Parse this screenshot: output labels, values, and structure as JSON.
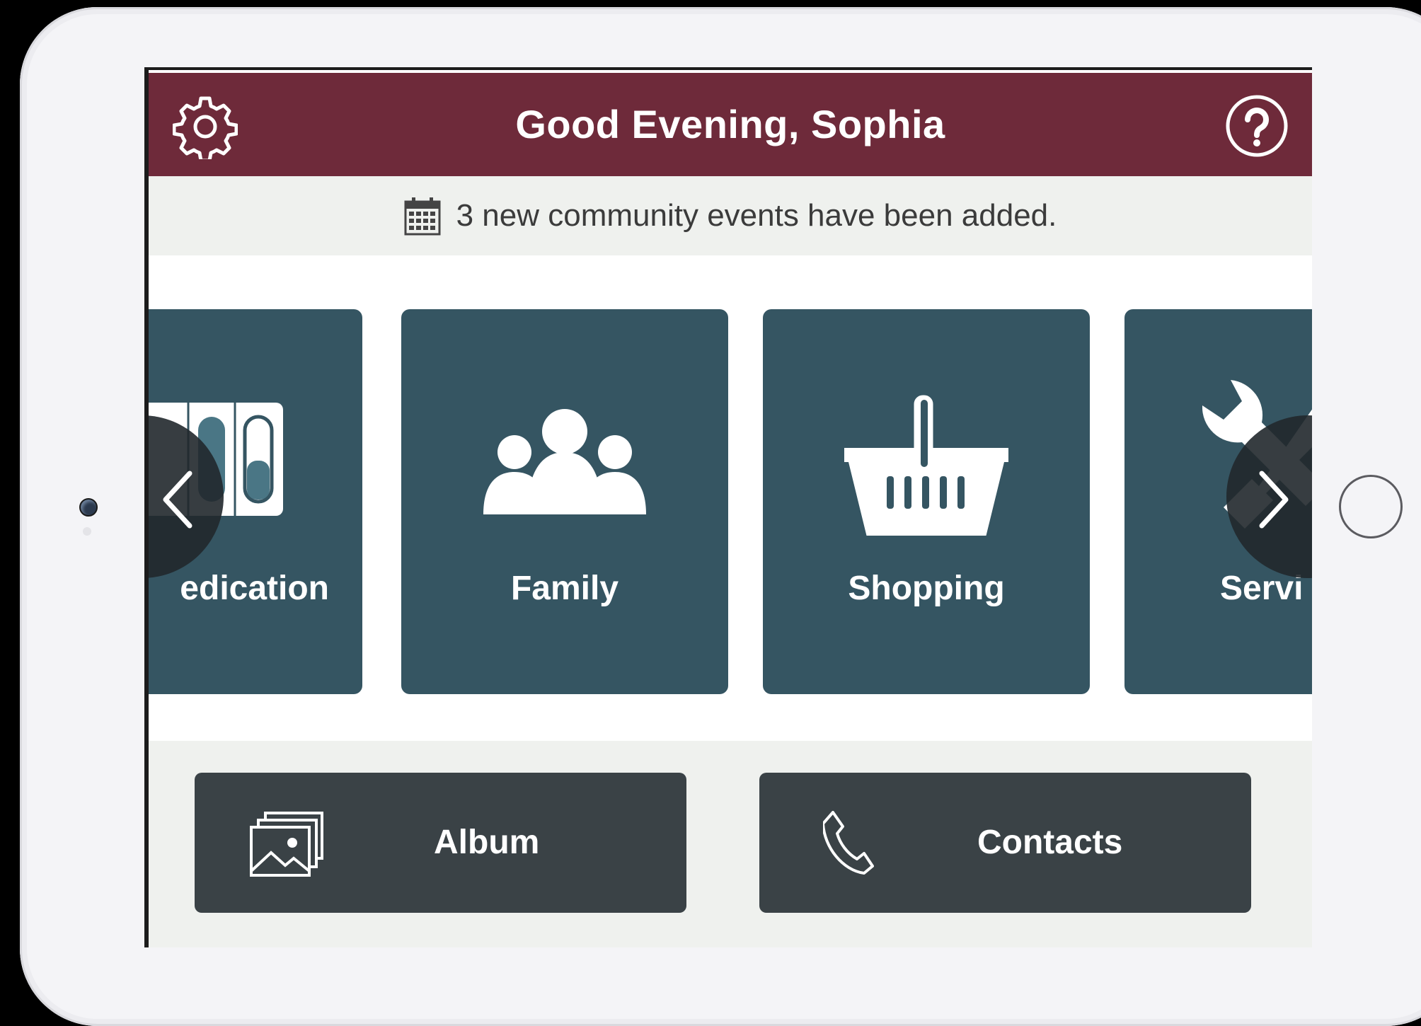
{
  "header": {
    "title": "Good Evening, Sophia",
    "background_color": "#6e2a3a",
    "settings_icon": "gear-icon",
    "help_icon": "question-circle-icon"
  },
  "notice": {
    "icon": "calendar-icon",
    "text": "3 new community events have been added."
  },
  "carousel": {
    "tile_color": "#355562",
    "tiles": [
      {
        "label": "edication",
        "icon": "pill-organizer-icon"
      },
      {
        "label": "Family",
        "icon": "people-group-icon"
      },
      {
        "label": "Shopping",
        "icon": "shopping-basket-icon"
      },
      {
        "label": "Servi",
        "icon": "wrench-screwdriver-icon"
      }
    ],
    "prev_icon": "chevron-left-icon",
    "next_icon": "chevron-right-icon"
  },
  "quick_actions": {
    "button_color": "#3a4246",
    "album": {
      "label": "Album",
      "icon": "photo-album-icon"
    },
    "contacts": {
      "label": "Contacts",
      "icon": "phone-icon"
    }
  }
}
